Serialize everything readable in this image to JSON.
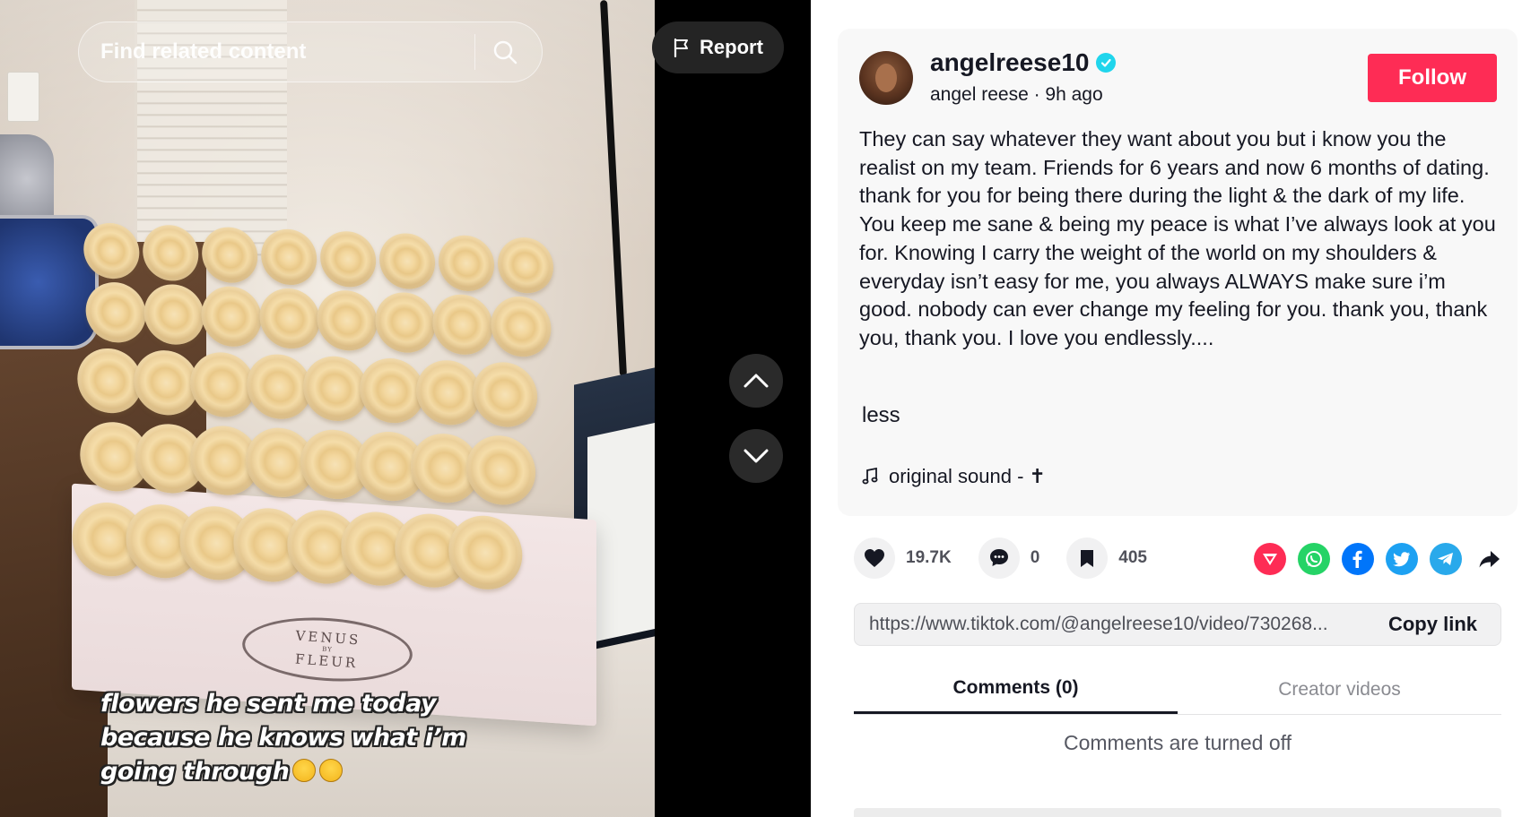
{
  "search": {
    "placeholder": "Find related content"
  },
  "report": {
    "label": "Report"
  },
  "video": {
    "caption_lines": [
      "flowers he sent me today",
      "because he knows what i’m",
      "going through"
    ],
    "box_brand": [
      "VENUS",
      "BY",
      "FLEUR"
    ]
  },
  "author": {
    "username": "angelreese10",
    "display_name": "angel reese",
    "posted": "9h ago",
    "separator": " · ",
    "verified": true
  },
  "follow": {
    "label": "Follow"
  },
  "description": "They can say whatever they want about you but i know you the realist on my team. Friends for 6 years and now 6 months of dating. thank for you for being there during the light & the dark of my life. You keep me sane & being my peace is what I’ve always look at you for. Knowing I carry the weight of the world on my shoulders & everyday isn’t easy for me, you always ALWAYS make sure i’m good. nobody can ever change my feeling for you. thank you, thank you, thank you. I love you endlessly....",
  "less_label": "less",
  "sound": {
    "label": "original sound - ✝"
  },
  "stats": {
    "likes": "19.7K",
    "comments": "0",
    "saves": "405"
  },
  "share": {
    "icons": [
      "send-icon",
      "whatsapp-icon",
      "facebook-icon",
      "twitter-icon",
      "telegram-icon",
      "share-arrow-icon"
    ]
  },
  "link": {
    "url": "https://www.tiktok.com/@angelreese10/video/730268...",
    "copy_label": "Copy link"
  },
  "tabs": [
    {
      "label": "Comments (0)"
    },
    {
      "label": "Creator videos"
    }
  ],
  "comments_status": "Comments are turned off",
  "colors": {
    "follow": "#fe2c55",
    "verified": "#20d5ec",
    "text": "#161823"
  }
}
